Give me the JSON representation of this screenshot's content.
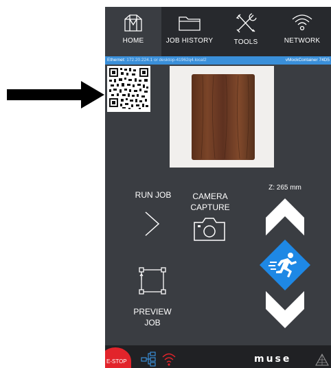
{
  "nav": {
    "items": [
      {
        "label": "HOME",
        "icon": "home-icon"
      },
      {
        "label": "JOB HISTORY",
        "icon": "folder-icon"
      },
      {
        "label": "TOOLS",
        "icon": "tools-icon"
      },
      {
        "label": "NETWORK",
        "icon": "wifi-icon"
      }
    ],
    "active": "HOME"
  },
  "network_bar": {
    "prefix": "Ethernet:",
    "address": "172.20.224.1  or desktop-41962q4.local2",
    "container": "vMockContainer  74D5"
  },
  "main": {
    "run_job_label": "RUN JOB",
    "camera_label_1": "CAMERA",
    "camera_label_2": "CAPTURE",
    "z_readout": "Z: 265 mm",
    "preview_label_1": "PREVIEW",
    "preview_label_2": "JOB"
  },
  "footer": {
    "estop_label": "E-STOP",
    "brand": "muse"
  },
  "colors": {
    "app_bg": "#3a3d42",
    "nav_bg": "#27292d",
    "accent_blue": "#1e88e5",
    "netbar_blue": "#3a8fd9",
    "estop_red": "#e2242b",
    "wood": "#6b3a22"
  }
}
